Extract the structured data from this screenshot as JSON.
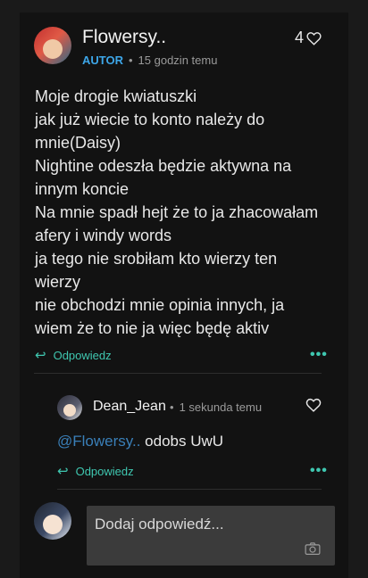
{
  "comment": {
    "username": "Flowersy..",
    "role_badge": "AUTOR",
    "time": "15 godzin temu",
    "like_count": "4",
    "text": "Moje drogie kwiatuszki\njak już wiecie to konto należy do mnie(Daisy)\nNightine odeszła będzie aktywna na innym koncie\nNa mnie spadł hejt że to ja zhacowałam afery i windy words\nja tego nie srobiłam kto wierzy ten wierzy\nnie obchodzi mnie opinia innych, ja wiem że to nie ja więc będę aktiv",
    "reply_label": "Odpowiedz",
    "more_label": "•••"
  },
  "reply": {
    "username": "Dean_Jean",
    "time": "1 sekunda temu",
    "mention": "@Flowersy..",
    "text": " odobs UwU",
    "reply_label": "Odpowiedz",
    "more_label": "•••"
  },
  "compose": {
    "placeholder": "Dodaj odpowiedź..."
  },
  "colors": {
    "accent": "#3fc7b0",
    "badge": "#3da6e8",
    "mention": "#3a7fb8"
  }
}
